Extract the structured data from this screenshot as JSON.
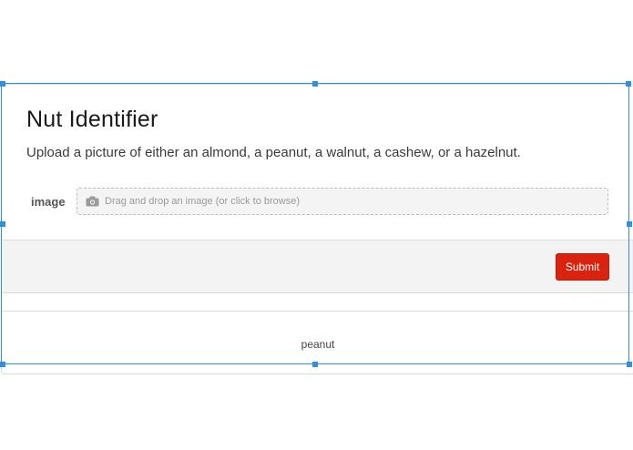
{
  "form": {
    "title": "Nut Identifier",
    "description": "Upload a picture of either an almond, a peanut, a walnut, a cashew, or a hazelnut.",
    "image_field": {
      "label": "image",
      "placeholder": "Drag and drop an image (or click to browse)",
      "icon": "camera-icon"
    },
    "submit_label": "Submit"
  },
  "result": {
    "text": "peanut"
  },
  "colors": {
    "submit_bg": "#d9230f",
    "selection": "#2f8fe0",
    "footer_bg": "#f3f3f3"
  }
}
